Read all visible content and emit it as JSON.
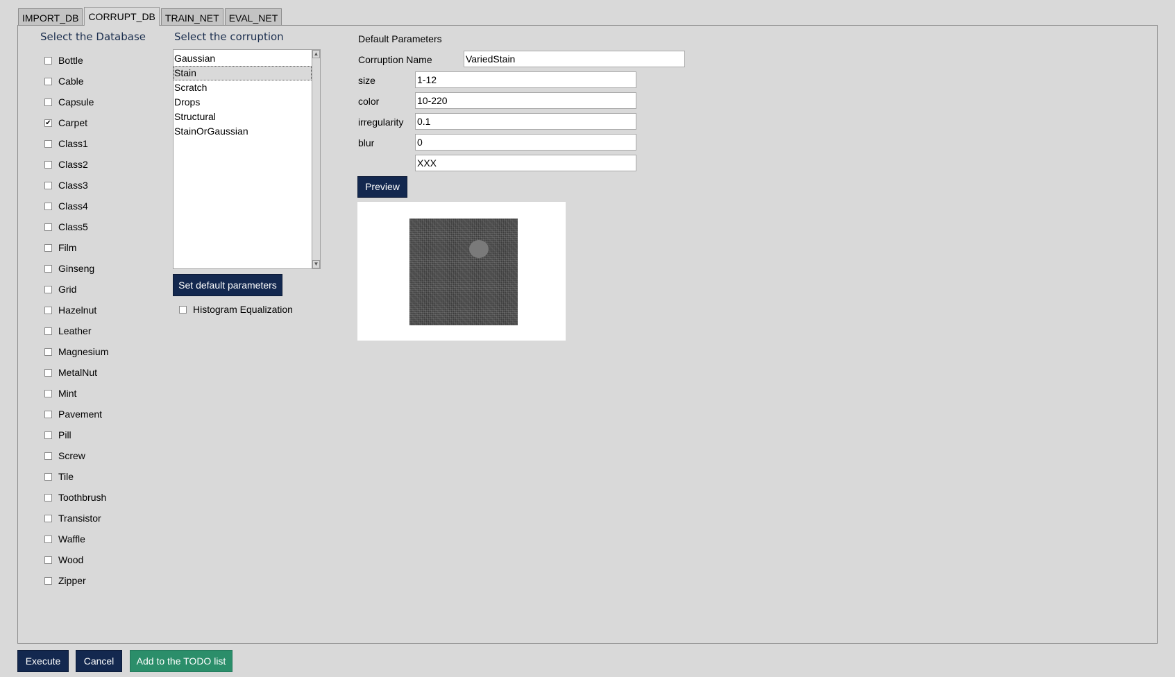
{
  "tabs": [
    {
      "label": "IMPORT_DB",
      "active": false
    },
    {
      "label": "CORRUPT_DB",
      "active": true
    },
    {
      "label": "TRAIN_NET",
      "active": false
    },
    {
      "label": "EVAL_NET",
      "active": false
    }
  ],
  "database": {
    "title": "Select the Database",
    "items": [
      {
        "label": "Bottle",
        "checked": false
      },
      {
        "label": "Cable",
        "checked": false
      },
      {
        "label": "Capsule",
        "checked": false
      },
      {
        "label": "Carpet",
        "checked": true
      },
      {
        "label": "Class1",
        "checked": false
      },
      {
        "label": "Class2",
        "checked": false
      },
      {
        "label": "Class3",
        "checked": false
      },
      {
        "label": "Class4",
        "checked": false
      },
      {
        "label": "Class5",
        "checked": false
      },
      {
        "label": "Film",
        "checked": false
      },
      {
        "label": "Ginseng",
        "checked": false
      },
      {
        "label": "Grid",
        "checked": false
      },
      {
        "label": "Hazelnut",
        "checked": false
      },
      {
        "label": "Leather",
        "checked": false
      },
      {
        "label": "Magnesium",
        "checked": false
      },
      {
        "label": "MetalNut",
        "checked": false
      },
      {
        "label": "Mint",
        "checked": false
      },
      {
        "label": "Pavement",
        "checked": false
      },
      {
        "label": "Pill",
        "checked": false
      },
      {
        "label": "Screw",
        "checked": false
      },
      {
        "label": "Tile",
        "checked": false
      },
      {
        "label": "Toothbrush",
        "checked": false
      },
      {
        "label": "Transistor",
        "checked": false
      },
      {
        "label": "Waffle",
        "checked": false
      },
      {
        "label": "Wood",
        "checked": false
      },
      {
        "label": "Zipper",
        "checked": false
      }
    ]
  },
  "corruption": {
    "title": "Select the corruption",
    "items": [
      "Gaussian",
      "Stain",
      "Scratch",
      "Drops",
      "Structural",
      "StainOrGaussian"
    ],
    "selected": "Stain",
    "set_default_label": "Set default parameters",
    "histogram_label": "Histogram Equalization",
    "histogram_checked": false
  },
  "parameters": {
    "title": "Default Parameters",
    "name_label": "Corruption Name",
    "name_value": "VariedStain",
    "size_label": "size",
    "size_value": "1-12",
    "color_label": "color",
    "color_value": "10-220",
    "irregularity_label": "irregularity",
    "irregularity_value": "0.1",
    "blur_label": "blur",
    "blur_value": "0",
    "extra_value": "XXX",
    "preview_label": "Preview"
  },
  "footer": {
    "execute_label": "Execute",
    "cancel_label": "Cancel",
    "todo_label": "Add to the TODO list"
  },
  "colors": {
    "button": "#13284f",
    "todo_button": "#2b8e6a",
    "title_text": "#1c2f4f",
    "background": "#d9d9d9"
  }
}
